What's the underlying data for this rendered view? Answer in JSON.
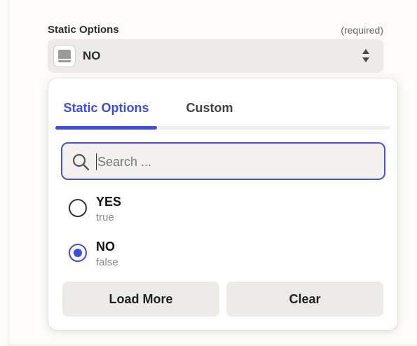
{
  "field": {
    "label": "Static Options",
    "required_text": "(required)",
    "selected_value": "NO"
  },
  "dropdown": {
    "tabs": [
      {
        "label": "Static Options",
        "active": true
      },
      {
        "label": "Custom",
        "active": false
      }
    ],
    "search": {
      "placeholder": "Search ...",
      "value": ""
    },
    "options": [
      {
        "label": "YES",
        "value": "true",
        "selected": false
      },
      {
        "label": "NO",
        "value": "false",
        "selected": true
      }
    ],
    "buttons": {
      "load_more": "Load More",
      "clear": "Clear"
    }
  },
  "colors": {
    "accent": "#3f4ce0",
    "field_bg": "#ecebe8",
    "page_bg": "#fdfcf8"
  }
}
